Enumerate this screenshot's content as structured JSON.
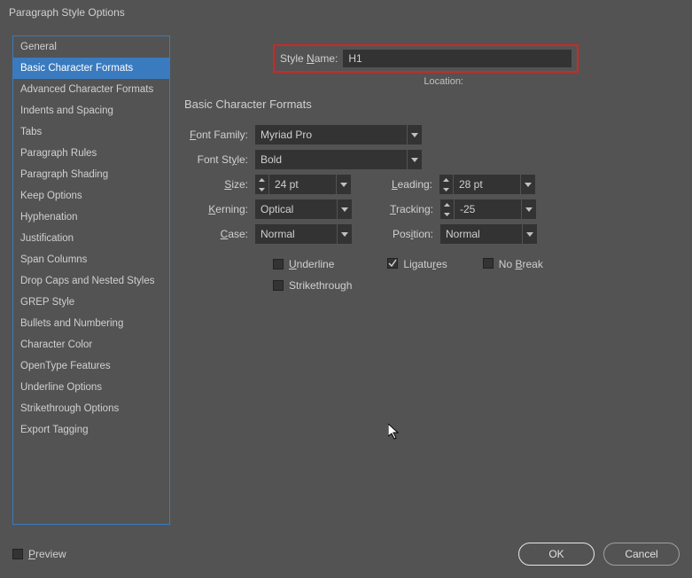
{
  "dialog": {
    "title": "Paragraph Style Options"
  },
  "sidebar": {
    "items": [
      "General",
      "Basic Character Formats",
      "Advanced Character Formats",
      "Indents and Spacing",
      "Tabs",
      "Paragraph Rules",
      "Paragraph Shading",
      "Keep Options",
      "Hyphenation",
      "Justification",
      "Span Columns",
      "Drop Caps and Nested Styles",
      "GREP Style",
      "Bullets and Numbering",
      "Character Color",
      "OpenType Features",
      "Underline Options",
      "Strikethrough Options",
      "Export Tagging"
    ],
    "selected_index": 1
  },
  "header": {
    "style_name_label": "Style Name:",
    "style_name_value": "H1",
    "location_label": "Location:"
  },
  "section": {
    "title": "Basic Character Formats"
  },
  "form": {
    "font_family_label": "Font Family:",
    "font_family_value": "Myriad Pro",
    "font_style_label": "Font Style:",
    "font_style_value": "Bold",
    "size_label": "Size:",
    "size_value": "24 pt",
    "leading_label": "Leading:",
    "leading_value": "28 pt",
    "kerning_label": "Kerning:",
    "kerning_value": "Optical",
    "tracking_label": "Tracking:",
    "tracking_value": "-25",
    "case_label": "Case:",
    "case_value": "Normal",
    "position_label": "Position:",
    "position_value": "Normal"
  },
  "checks": {
    "underline": "Underline",
    "strikethrough": "Strikethrough",
    "ligatures": "Ligatures",
    "no_break": "No Break",
    "underline_checked": false,
    "strikethrough_checked": false,
    "ligatures_checked": true,
    "no_break_checked": false
  },
  "footer": {
    "preview": "Preview",
    "preview_checked": false,
    "ok": "OK",
    "cancel": "Cancel"
  }
}
